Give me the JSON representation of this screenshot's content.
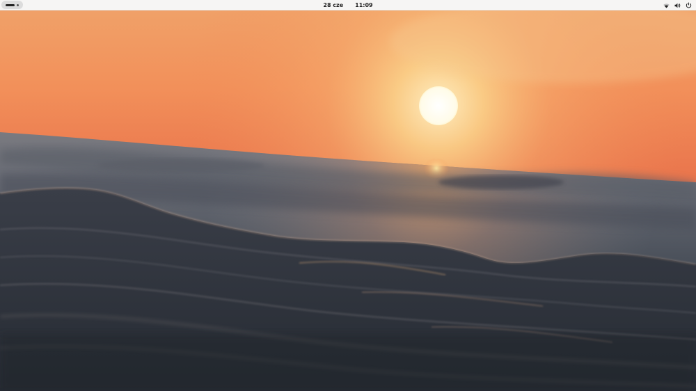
{
  "topbar": {
    "activities": {
      "icon": "activities-indicator-icon"
    },
    "clock": {
      "date": "28 cze",
      "time": "11:09"
    },
    "status_icons": [
      "wifi-icon",
      "volume-icon",
      "power-icon"
    ]
  },
  "wallpaper": {
    "description_colors": {
      "sky_top": "#e88a4a",
      "sky_glow": "#f6c878",
      "sun": "#fffdf0",
      "sea_far": "#6b6f7a",
      "sea_near": "#2a3038"
    }
  },
  "colors": {
    "topbar_bg": "#f6f5f4",
    "topbar_text": "#222222"
  }
}
